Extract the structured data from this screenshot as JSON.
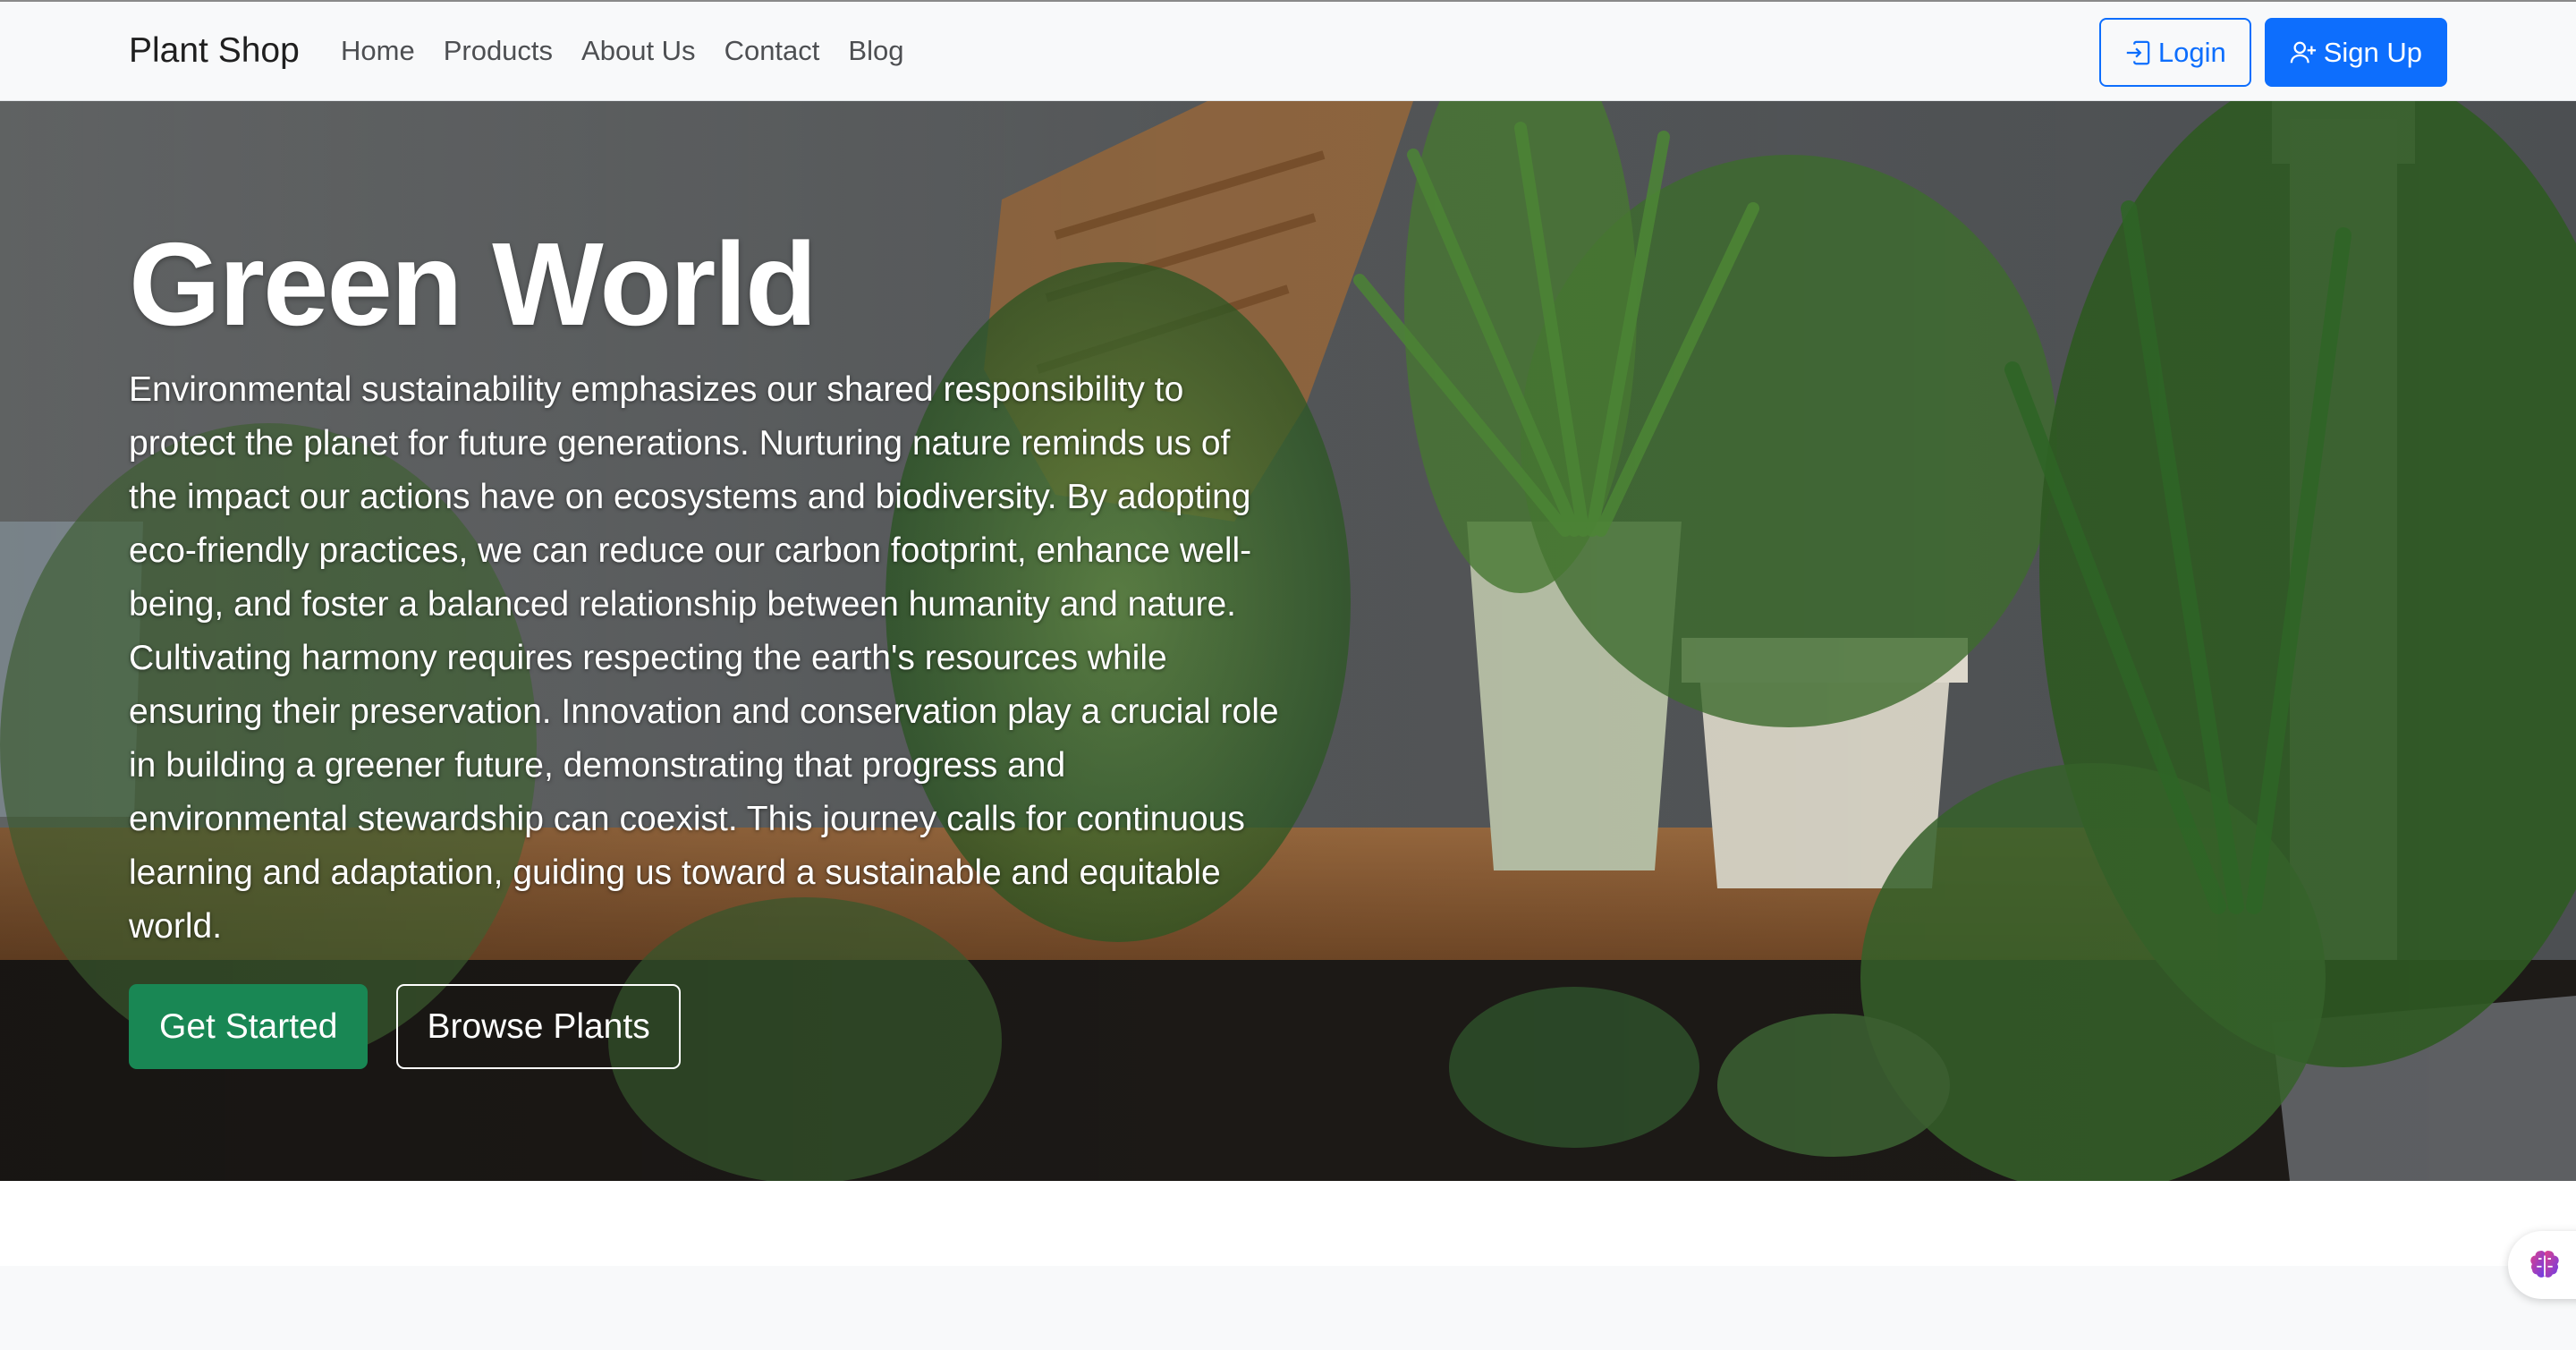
{
  "navbar": {
    "brand": "Plant Shop",
    "links": [
      "Home",
      "Products",
      "About Us",
      "Contact",
      "Blog"
    ],
    "login_label": "Login",
    "signup_label": "Sign Up",
    "login_icon": "login-arrow-icon",
    "signup_icon": "person-plus-icon"
  },
  "hero": {
    "title": "Green World",
    "text": "Environmental sustainability emphasizes our shared responsibility to protect the planet for future generations. Nurturing nature reminds us of the impact our actions have on ecosystems and biodiversity. By adopting eco-friendly practices, we can reduce our carbon footprint, enhance well-being, and foster a balanced relationship between humanity and nature. Cultivating harmony requires respecting the earth's resources while ensuring their preservation. Innovation and conservation play a crucial role in building a greener future, demonstrating that progress and environmental stewardship can coexist. This journey calls for continuous learning and adaptation, guiding us toward a sustainable and equitable world.",
    "primary_cta": "Get Started",
    "secondary_cta": "Browse Plants"
  },
  "floating": {
    "icon": "brain-icon"
  },
  "colors": {
    "primary": "#0d6efd",
    "success": "#198754",
    "navbar_bg": "#f8f9fa"
  }
}
